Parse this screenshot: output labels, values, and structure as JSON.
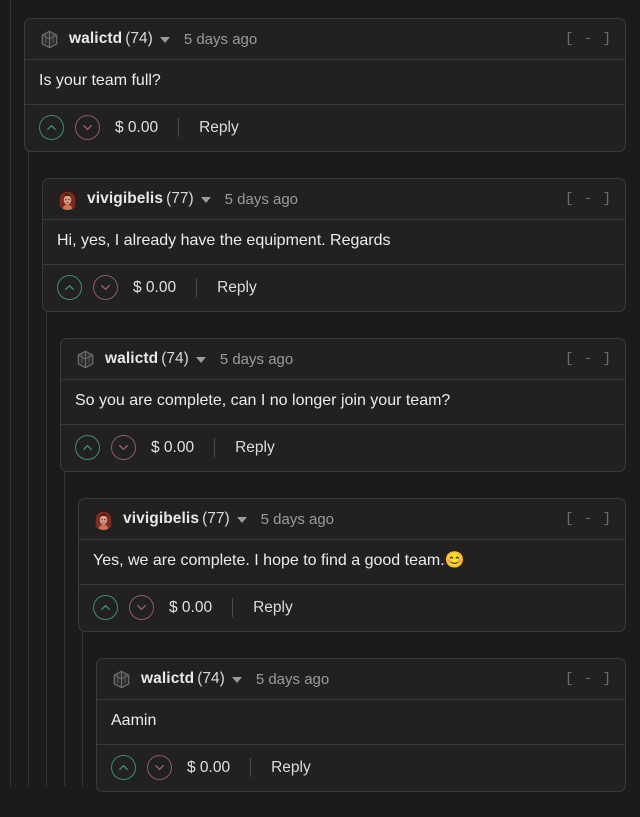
{
  "theme": {
    "page_background": "#1b1b1b",
    "card_background": "#212121",
    "card_border": "#3a3a3a",
    "upvote_color": "#3e8e6d",
    "downvote_color": "#8d5c5f",
    "text_primary": "#ececec",
    "text_muted": "#9b9b9b",
    "guide_line": "#343434"
  },
  "labels": {
    "collapse": "[ - ]",
    "reply": "Reply",
    "caret_icon": "chevron-down-icon"
  },
  "comments": [
    {
      "id": "c1",
      "depth": 0,
      "author": "walictd",
      "reputation": "(74)",
      "avatar_type": "cube-avatar",
      "timestamp": "5 days ago",
      "collapse": "[ - ]",
      "body": "Is your team full?",
      "payout": "$ 0.00",
      "reply": "Reply"
    },
    {
      "id": "c2",
      "depth": 1,
      "author": "vivigibelis",
      "reputation": "(77)",
      "avatar_type": "photo-avatar",
      "timestamp": "5 days ago",
      "collapse": "[ - ]",
      "body": "Hi, yes, I already have the equipment. Regards",
      "payout": "$ 0.00",
      "reply": "Reply"
    },
    {
      "id": "c3",
      "depth": 2,
      "author": "walictd",
      "reputation": "(74)",
      "avatar_type": "cube-avatar",
      "timestamp": "5 days ago",
      "collapse": "[ - ]",
      "body": "So you are complete, can I no longer join your team?",
      "payout": "$ 0.00",
      "reply": "Reply"
    },
    {
      "id": "c4",
      "depth": 3,
      "author": "vivigibelis",
      "reputation": "(77)",
      "avatar_type": "photo-avatar",
      "timestamp": "5 days ago",
      "collapse": "[ - ]",
      "body": "Yes, we are complete. I hope to find a good team.😊",
      "payout": "$ 0.00",
      "reply": "Reply"
    },
    {
      "id": "c5",
      "depth": 4,
      "author": "walictd",
      "reputation": "(74)",
      "avatar_type": "cube-avatar",
      "timestamp": "5 days ago",
      "collapse": "[ - ]",
      "body": "Aamin",
      "payout": "$ 0.00",
      "reply": "Reply"
    }
  ]
}
